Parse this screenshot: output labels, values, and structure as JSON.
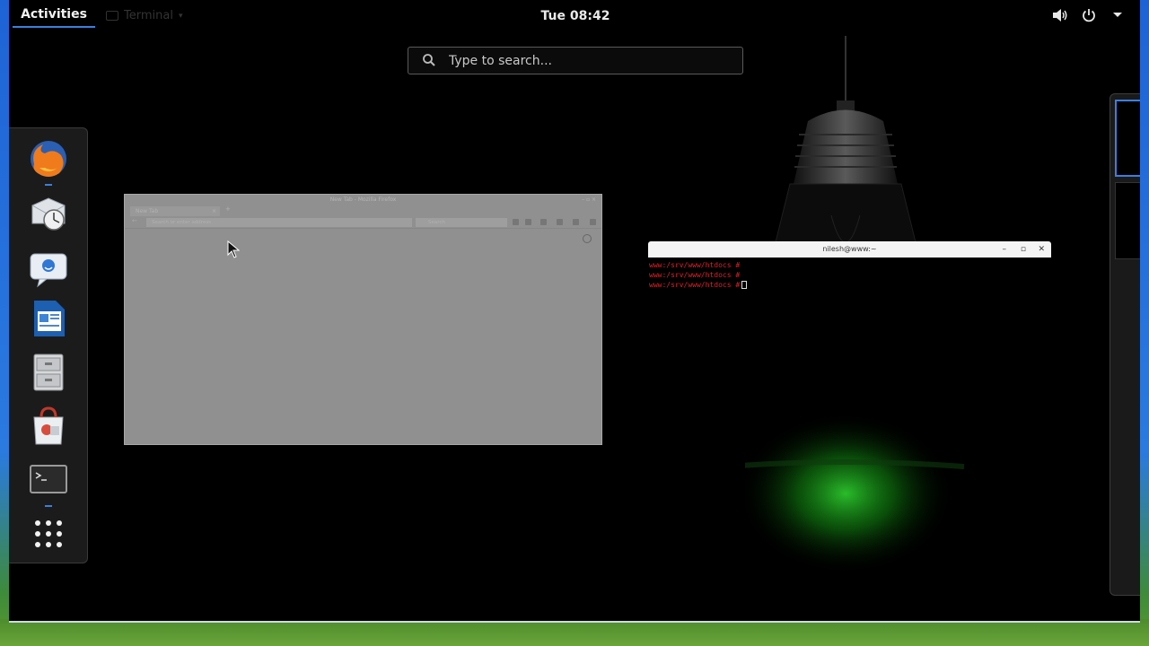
{
  "topbar": {
    "activities_label": "Activities",
    "app_menu_label": "Terminal",
    "clock": "Tue 08:42",
    "status_icons": [
      "volume-icon",
      "power-icon",
      "dropdown-arrow-icon"
    ]
  },
  "search": {
    "placeholder": "Type to search..."
  },
  "dash": {
    "apps": [
      {
        "name": "Firefox",
        "icon": "firefox-icon",
        "running": true
      },
      {
        "name": "Evolution",
        "icon": "evolution-mail-icon",
        "running": false
      },
      {
        "name": "Empathy",
        "icon": "chat-icon",
        "running": false
      },
      {
        "name": "LibreOffice Writer",
        "icon": "writer-document-icon",
        "running": false
      },
      {
        "name": "Files",
        "icon": "file-cabinet-icon",
        "running": false
      },
      {
        "name": "Software",
        "icon": "software-bag-icon",
        "running": false
      },
      {
        "name": "Terminal",
        "icon": "terminal-icon",
        "running": true
      },
      {
        "name": "Show Applications",
        "icon": "app-grid-icon",
        "running": false
      }
    ]
  },
  "firefox_window": {
    "title": "New Tab - Mozilla Firefox",
    "tab_label": "New Tab",
    "url_placeholder": "Search or enter address",
    "search_placeholder": "Search"
  },
  "terminal_window": {
    "title": "nilesh@www:~",
    "lines": [
      "www:/srv/www/htdocs #",
      "www:/srv/www/htdocs #",
      "www:/srv/www/htdocs #"
    ]
  },
  "colors": {
    "accent": "#3b7fe0",
    "terminal_prompt": "#e0202a",
    "wallpaper_glow": "#1fa31f"
  }
}
